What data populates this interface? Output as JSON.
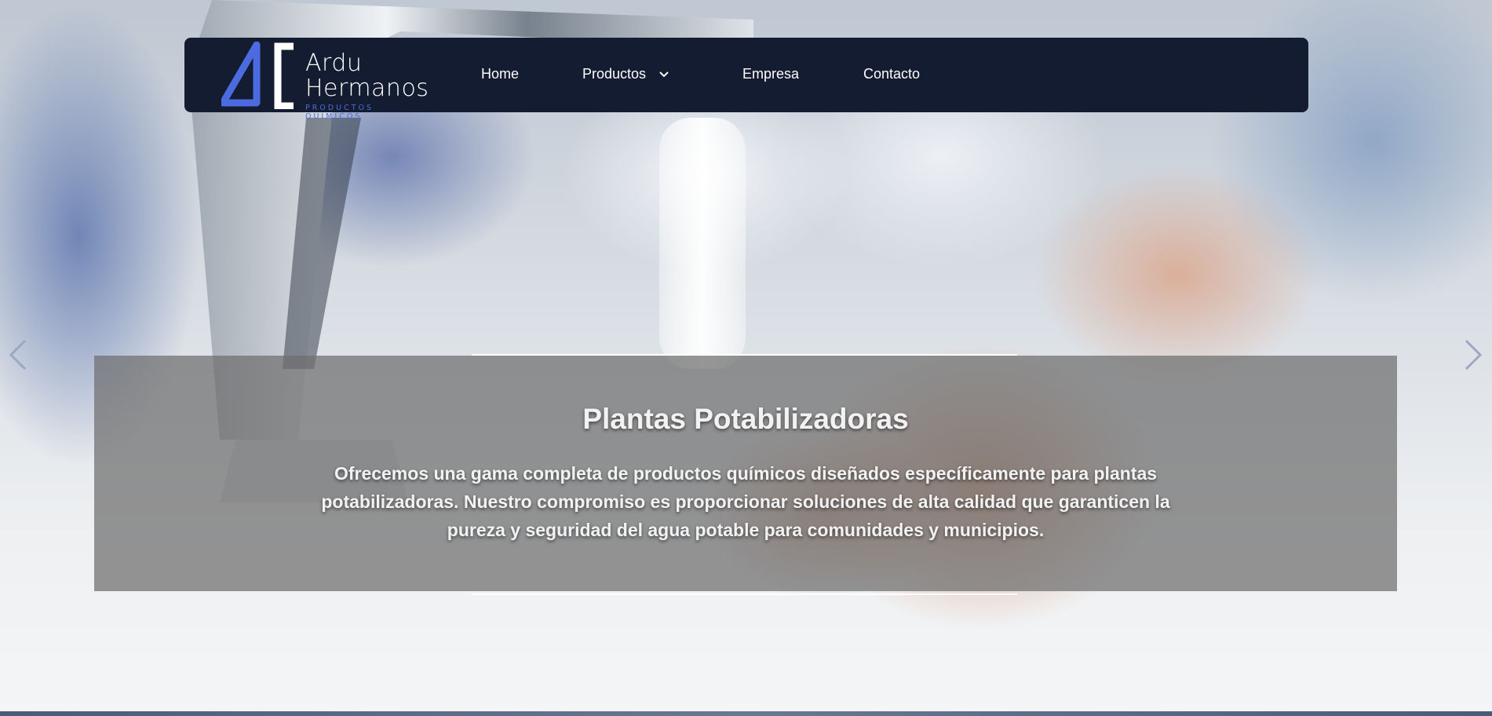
{
  "brand": {
    "name_line_1": "Ardu",
    "name_line_2": "Hermanos",
    "tagline": "PRODUCTOS QUIMICOS",
    "accent_color": "#4d6be0",
    "navbar_color": "#131c30"
  },
  "nav": {
    "items": [
      {
        "label": "Home",
        "icon": null
      },
      {
        "label": "Productos",
        "icon": "chevron-down-icon"
      },
      {
        "label": "Empresa",
        "icon": null
      },
      {
        "label": "Contacto",
        "icon": null
      }
    ]
  },
  "carousel": {
    "prev_icon": "chevron-left-icon",
    "next_icon": "chevron-right-icon",
    "slide": {
      "title": "Plantas Potabilizadoras",
      "text": "Ofrecemos una gama completa de productos químicos diseñados específicamente para plantas potabilizadoras. Nuestro compromiso es proporcionar soluciones de alta calidad que garanticen la pureza y seguridad del agua potable para comunidades y municipios."
    }
  }
}
